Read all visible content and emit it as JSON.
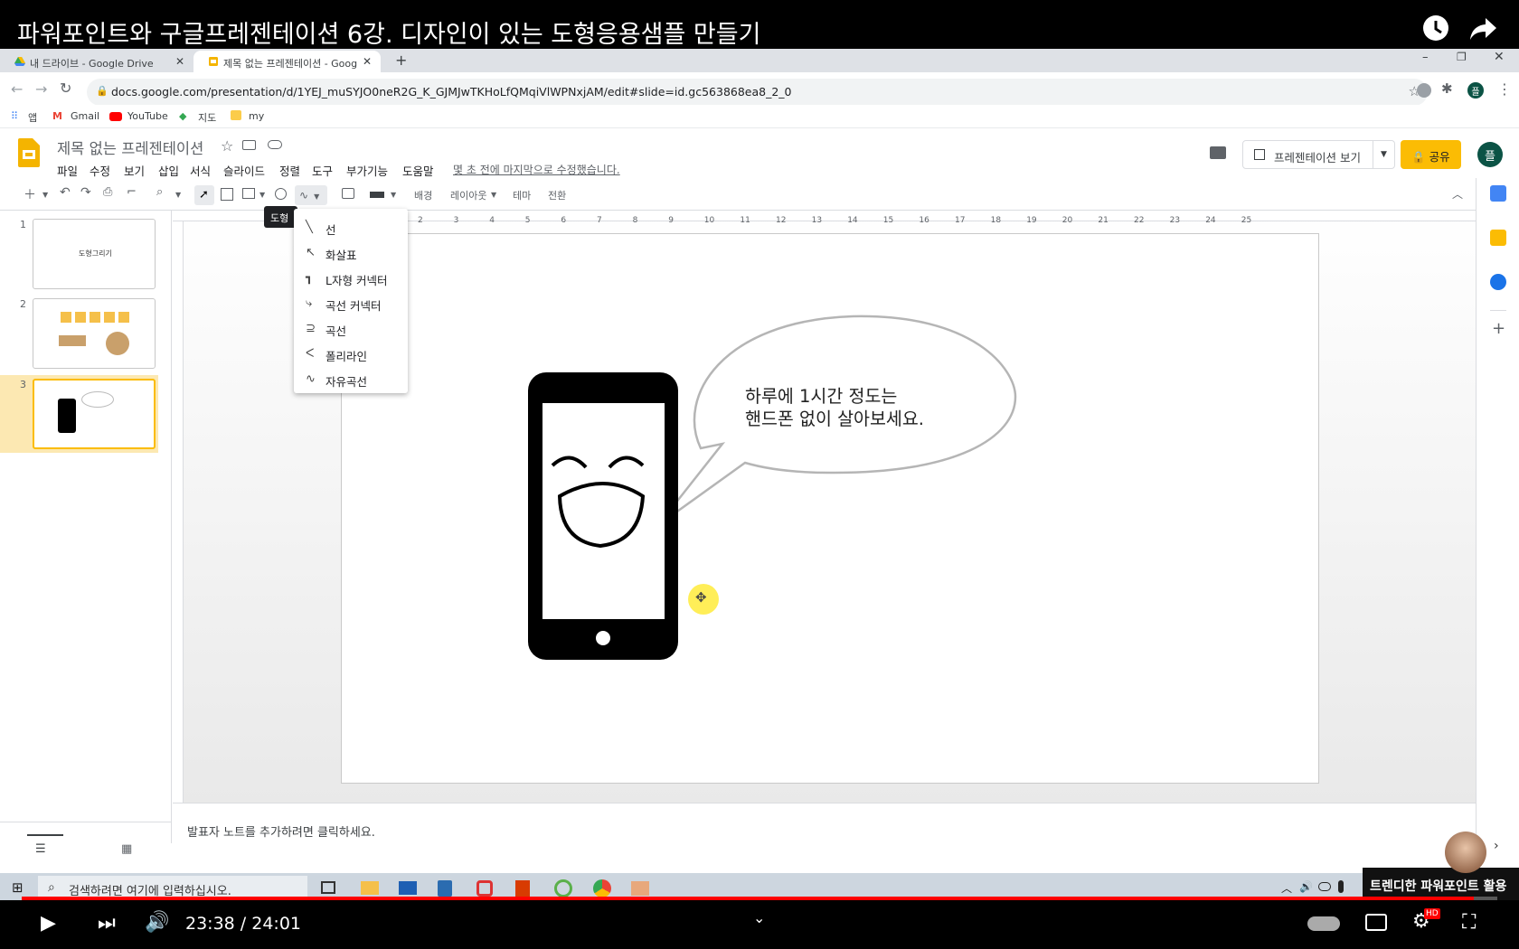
{
  "video": {
    "title": "파워포인트와 구글프레젠테이션 6강. 디자인이 있는 도형응용샘플 만들기",
    "time": "23:38 / 24:01",
    "progress_fraction": 0.984,
    "channel_badge": "트렌디한 파워포인트 활용",
    "hd_badge": "HD"
  },
  "browser": {
    "tabs": [
      {
        "label": "내 드라이브 - Google Drive",
        "active": false
      },
      {
        "label": "제목 없는 프레젠테이션 - Goog",
        "active": true
      }
    ],
    "url": "docs.google.com/presentation/d/1YEJ_muSYJO0neR2G_K_GJMJwTKHoLfQMqiVlWPNxjAM/edit#slide=id.gc563868ea8_2_0",
    "bookmarks": [
      "앱",
      "Gmail",
      "YouTube",
      "지도",
      "my"
    ]
  },
  "slides": {
    "doc_title": "제목 없는 프레젠테이션",
    "menu": [
      "파일",
      "수정",
      "보기",
      "삽입",
      "서식",
      "슬라이드",
      "정렬",
      "도구",
      "부가기능",
      "도움말"
    ],
    "last_edit": "몇 초 전에 마지막으로 수정했습니다.",
    "present_button": "프레젠테이션 보기",
    "share_button": "공유",
    "avatar_initial": "플",
    "toolbar": {
      "background": "배경",
      "layout": "레이아웃",
      "theme": "테마",
      "transition": "전환"
    },
    "tooltip": "도형",
    "shape_menu": [
      {
        "label": "선",
        "icon": "line-icon"
      },
      {
        "label": "화살표",
        "icon": "arrow-icon"
      },
      {
        "label": "L자형 커넥터",
        "icon": "elbow-connector-icon"
      },
      {
        "label": "곡선 커넥터",
        "icon": "curved-connector-icon"
      },
      {
        "label": "곡선",
        "icon": "curve-icon"
      },
      {
        "label": "폴리라인",
        "icon": "polyline-icon"
      },
      {
        "label": "자유곡선",
        "icon": "scribble-icon"
      }
    ],
    "thumbnails": [
      {
        "num": "1",
        "text": "도형그리기"
      },
      {
        "num": "2",
        "text": ""
      },
      {
        "num": "3",
        "text": ""
      }
    ],
    "ruler_numbers": [
      "2",
      "3",
      "4",
      "5",
      "6",
      "7",
      "8",
      "9",
      "10",
      "11",
      "12",
      "13",
      "14",
      "15",
      "16",
      "17",
      "18",
      "19",
      "20",
      "21",
      "22",
      "23",
      "24",
      "25"
    ],
    "bubble_text_line1": "하루에 1시간 정도는",
    "bubble_text_line2": "핸드폰 없이 살아보세요.",
    "notes_placeholder": "발표자 노트를 추가하려면 클릭하세요."
  },
  "taskbar": {
    "search_placeholder": "검색하려면 여기에 입력하십시오."
  },
  "colors": {
    "accent_yellow": "#fbbc04",
    "slides_yellow": "#f4b400",
    "progress_red": "#ff0000"
  }
}
